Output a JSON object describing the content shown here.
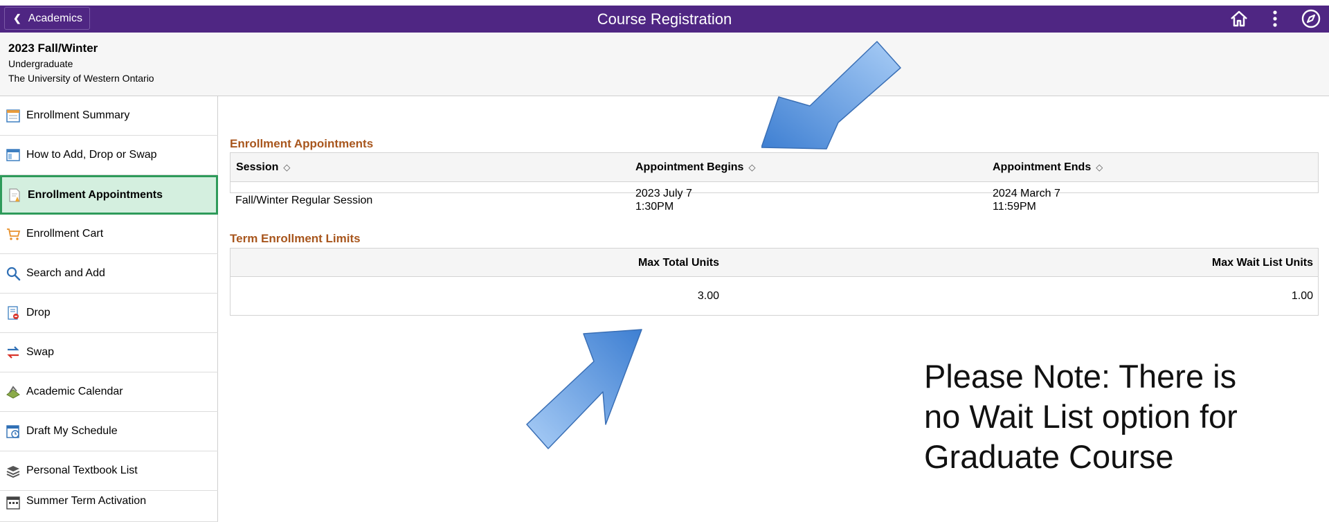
{
  "header": {
    "back_label": "Academics",
    "title": "Course Registration",
    "brand_color": "#4f2683",
    "icons": [
      "home-icon",
      "more-vertical-icon",
      "navbar-compass-icon"
    ]
  },
  "context": {
    "term": "2023 Fall/Winter",
    "career": "Undergraduate",
    "institution": "The University of Western Ontario"
  },
  "sidebar": {
    "items": [
      {
        "label": "Enrollment Summary",
        "icon": "calendar-icon"
      },
      {
        "label": "How to Add, Drop or Swap",
        "icon": "window-icon"
      },
      {
        "label": "Enrollment Appointments",
        "icon": "appointment-doc-icon",
        "active": true
      },
      {
        "label": "Enrollment Cart",
        "icon": "cart-icon"
      },
      {
        "label": "Search and Add",
        "icon": "search-icon"
      },
      {
        "label": "Drop",
        "icon": "drop-doc-icon"
      },
      {
        "label": "Swap",
        "icon": "swap-icon"
      },
      {
        "label": "Academic Calendar",
        "icon": "academic-calendar-icon"
      },
      {
        "label": "Draft My Schedule",
        "icon": "schedule-icon"
      },
      {
        "label": "Personal Textbook List",
        "icon": "books-icon"
      },
      {
        "label": "Summer Term Activation",
        "icon": "calendar-grid-icon"
      }
    ]
  },
  "appointments": {
    "title": "Enrollment Appointments",
    "columns": [
      "Session",
      "Appointment Begins",
      "Appointment Ends"
    ],
    "rows": [
      {
        "session": "Fall/Winter Regular Session",
        "begins_date": "2023 July 7",
        "begins_time": "1:30PM",
        "ends_date": "2024 March 7",
        "ends_time": "11:59PM"
      }
    ]
  },
  "limits": {
    "title": "Term Enrollment Limits",
    "columns": [
      "Max Total Units",
      "Max Wait List Units"
    ],
    "values": [
      "3.00",
      "1.00"
    ]
  },
  "annotation": {
    "note_lines": [
      "Please Note: There is",
      "no Wait List option for",
      "Graduate Course"
    ],
    "arrow_color": "#5a9be8"
  }
}
